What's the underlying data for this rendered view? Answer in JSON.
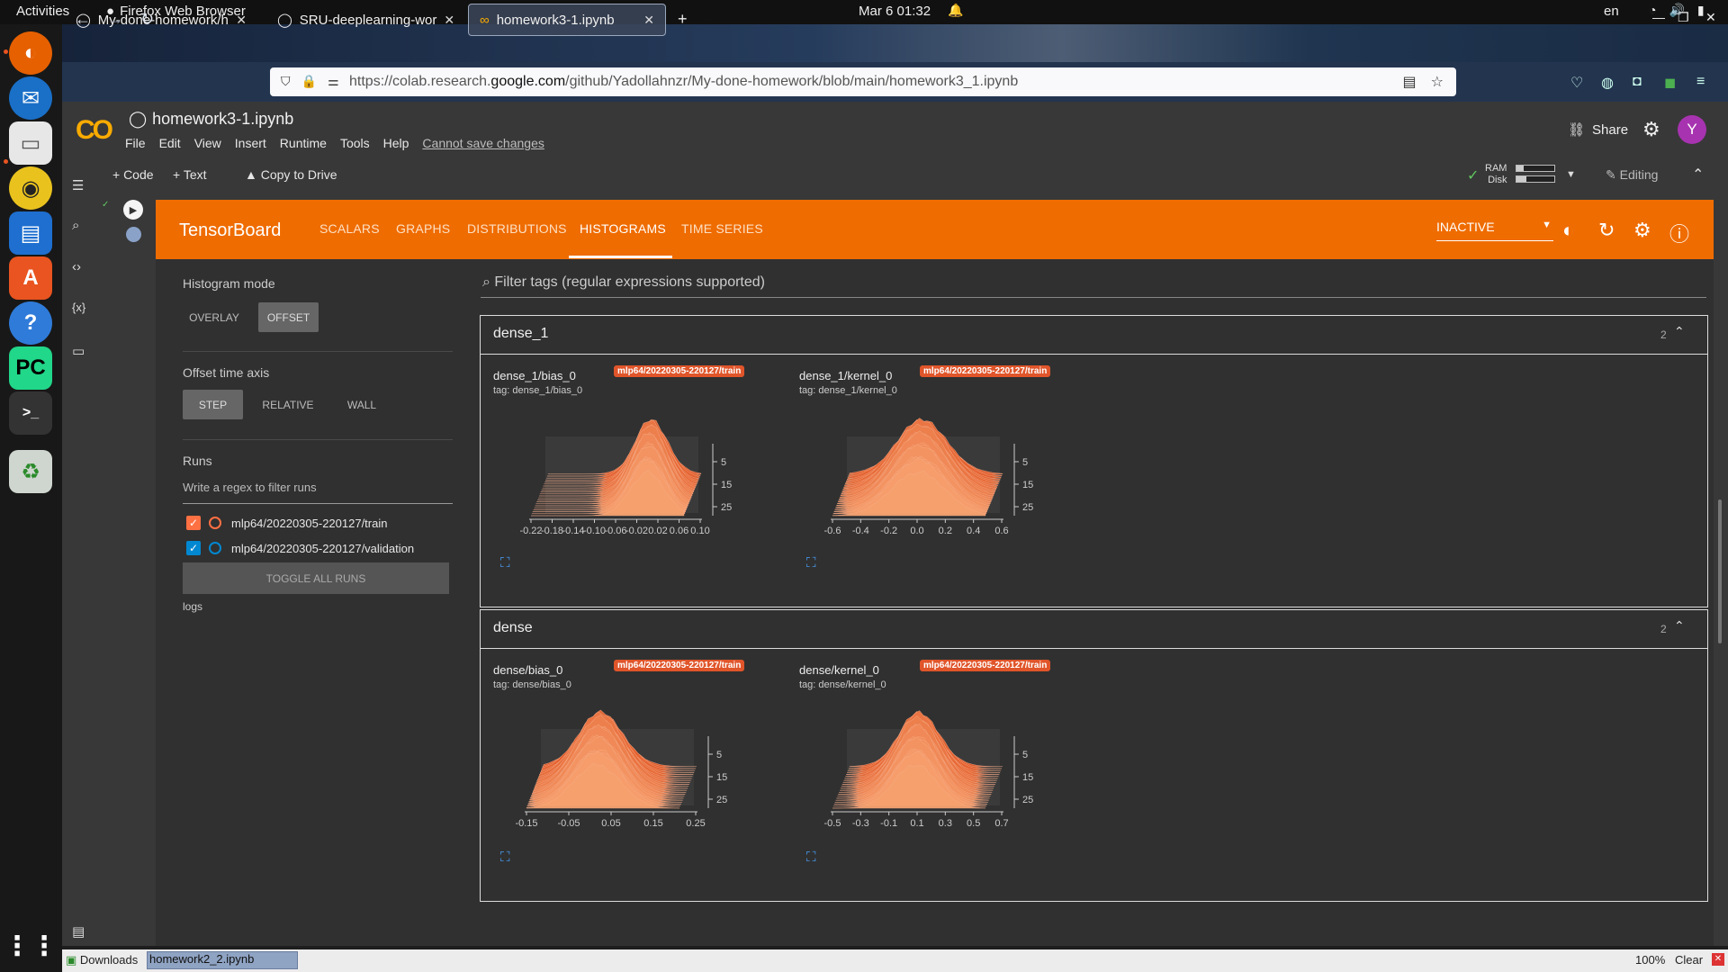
{
  "os": {
    "activities": "Activities",
    "app_name": "Firefox Web Browser",
    "clock": "Mar 6  01:32",
    "lang": "en"
  },
  "browser": {
    "tabs": [
      {
        "label": "My-done-homework/h"
      },
      {
        "label": "SRU-deeplearning-wor"
      },
      {
        "label": "homework3-1.ipynb"
      }
    ],
    "url_prefix": "https://colab.research.",
    "url_host": "google.com",
    "url_path": "/github/Yadollahnzr/My-done-homework/blob/main/homework3_1.ipynb"
  },
  "colab": {
    "logo": "CO",
    "notebook_title": "homework3-1.ipynb",
    "menu": [
      "File",
      "Edit",
      "View",
      "Insert",
      "Runtime",
      "Tools",
      "Help"
    ],
    "cant_save": "Cannot save changes",
    "share": "Share",
    "avatar_letter": "Y",
    "toolbar": {
      "code": "+ Code",
      "text": "+ Text",
      "copy_drive": "Copy to Drive",
      "ram": "RAM",
      "disk": "Disk",
      "editing": "Editing"
    },
    "ram_usage": 0.2,
    "disk_usage": 0.25
  },
  "tensorboard": {
    "brand": "TensorBoard",
    "tabs": [
      "SCALARS",
      "GRAPHS",
      "DISTRIBUTIONS",
      "HISTOGRAMS",
      "TIME SERIES"
    ],
    "active_tab": "HISTOGRAMS",
    "status": "INACTIVE",
    "sidebar": {
      "histogram_mode_label": "Histogram mode",
      "overlay": "OVERLAY",
      "offset": "OFFSET",
      "offset_axis_label": "Offset time axis",
      "step": "STEP",
      "relative": "RELATIVE",
      "wall": "WALL",
      "runs_label": "Runs",
      "filter_runs_placeholder": "Write a regex to filter runs",
      "runs": [
        {
          "name": "mlp64/20220305-220127/train",
          "color": "#ff7043",
          "checked": true
        },
        {
          "name": "mlp64/20220305-220127/validation",
          "color": "#0288d1",
          "checked": true
        }
      ],
      "toggle_all": "TOGGLE ALL RUNS",
      "logdir": "logs"
    },
    "filter_tags_placeholder": "Filter tags (regular expressions supported)",
    "groups": [
      {
        "name": "dense_1",
        "count": "2",
        "cards": [
          {
            "title": "dense_1/bias_0",
            "tag": "tag: dense_1/bias_0",
            "run": "mlp64/20220305-220127/train",
            "xticks": [
              "-0.22",
              "-0.18",
              "-0.14",
              "-0.10",
              "-0.06",
              "-0.02",
              "0.02",
              "0.06",
              "0.10"
            ],
            "yticks": [
              "5",
              "15",
              "25"
            ]
          },
          {
            "title": "dense_1/kernel_0",
            "tag": "tag: dense_1/kernel_0",
            "run": "mlp64/20220305-220127/train",
            "xticks": [
              "-0.6",
              "-0.4",
              "-0.2",
              "0.0",
              "0.2",
              "0.4",
              "0.6"
            ],
            "yticks": [
              "5",
              "15",
              "25"
            ]
          }
        ]
      },
      {
        "name": "dense",
        "count": "2",
        "cards": [
          {
            "title": "dense/bias_0",
            "tag": "tag: dense/bias_0",
            "run": "mlp64/20220305-220127/train",
            "xticks": [
              "-0.15",
              "-0.05",
              "0.05",
              "0.15",
              "0.25"
            ],
            "yticks": [
              "5",
              "15",
              "25"
            ]
          },
          {
            "title": "dense/kernel_0",
            "tag": "tag: dense/kernel_0",
            "run": "mlp64/20220305-220127/train",
            "xticks": [
              "-0.5",
              "-0.3",
              "-0.1",
              "0.1",
              "0.3",
              "0.5",
              "0.7"
            ],
            "yticks": [
              "5",
              "15",
              "25"
            ]
          }
        ]
      }
    ]
  },
  "statusbar": {
    "downloads": "Downloads",
    "file": "homework2_2.ipynb",
    "zoom": "100%",
    "clear": "Clear"
  },
  "colors": {
    "tb_orange": "#ef6c00",
    "hist_fill": "#e2572b",
    "hist_light": "#f6a07a"
  }
}
